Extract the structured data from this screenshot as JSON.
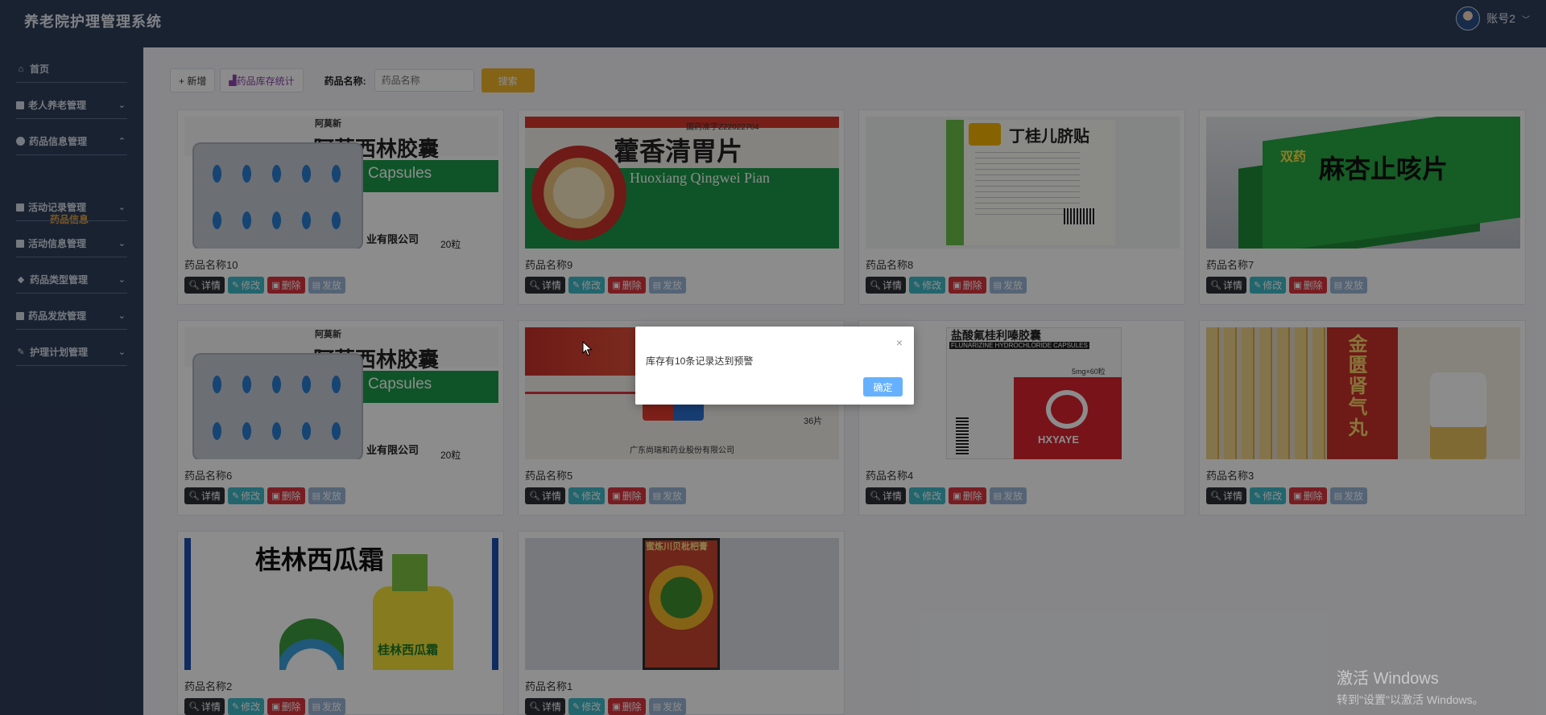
{
  "app": {
    "title": "养老院护理管理系统",
    "user_name": "账号2"
  },
  "sidebar": {
    "items": [
      {
        "label": "首页",
        "icon": "home-icon"
      },
      {
        "label": "老人养老管理",
        "icon": "grid-icon"
      },
      {
        "label": "药品信息管理",
        "icon": "circle-icon"
      },
      {
        "label": "活动记录管理",
        "icon": "grid-icon"
      },
      {
        "label": "活动信息管理",
        "icon": "grid-icon"
      },
      {
        "label": "药品类型管理",
        "icon": "tag-icon"
      },
      {
        "label": "药品发放管理",
        "icon": "grid-icon"
      },
      {
        "label": "护理计划管理",
        "icon": "tool-icon"
      }
    ],
    "active_sub": "药品信息"
  },
  "toolbar": {
    "add_label": "+ 新增",
    "stats_label": "药品库存统计",
    "search_label": "药品名称:",
    "search_placeholder": "药品名称",
    "search_button": "搜索"
  },
  "card_actions": {
    "detail": "详情",
    "edit": "修改",
    "delete": "删除",
    "issue": "发放"
  },
  "cards": [
    {
      "name": "药品名称10",
      "art": "amox"
    },
    {
      "name": "药品名称9",
      "art": "huoxiang"
    },
    {
      "name": "药品名称8",
      "art": "dinggui"
    },
    {
      "name": "药品名称7",
      "art": "maxing"
    },
    {
      "name": "药品名称6",
      "art": "amox"
    },
    {
      "name": "药品名称5",
      "art": "redbox"
    },
    {
      "name": "药品名称4",
      "art": "hxyaye"
    },
    {
      "name": "药品名称3",
      "art": "jinkui"
    },
    {
      "name": "药品名称2",
      "art": "guilin"
    },
    {
      "name": "药品名称1",
      "art": "chuanbei"
    }
  ],
  "product_art": {
    "amox_brand": "阿莫新",
    "amox_cn": "阿莫西林胶囊",
    "amox_en": "xicillin Capsules",
    "amox_co": "业有限公司",
    "amox_qty": "20粒",
    "huoxiang_cn": "藿香清胃片",
    "huoxiang_en": "Huoxiang Qingwei Pian",
    "huoxiang_approval": "国药准字Z22022704",
    "dinggui_cn": "丁桂儿脐贴",
    "maxing_brand": "双药",
    "maxing_cn": "麻杏止咳片",
    "hxyaye_top": "盐酸氟桂利嗪胶囊",
    "hxyaye_en": "FLUNARIZINE HYDROCHLORIDE CAPSULES",
    "hxyaye_spec": "5mg×60粒",
    "hxyaye_brand": "HXYAYE",
    "redbox_qty": "36片",
    "redbox_co": "广东尚瑞和药业股份有限公司",
    "jinkui_cn": "金匮肾气丸",
    "guilin_cn": "桂林西瓜霜",
    "chuanbei_cn": "蜜炼川贝枇杷膏"
  },
  "dialog": {
    "message": "库存有10条记录达到预警",
    "ok_label": "确定",
    "close_label": "×"
  },
  "watermark": {
    "line1": "激活 Windows",
    "line2": "转到\"设置\"以激活 Windows。"
  },
  "colors": {
    "header_bg": "#2f3e59",
    "active_sub": "#e6a23c",
    "search_btn": "#f0b429",
    "ok_btn": "#66b1ff"
  }
}
